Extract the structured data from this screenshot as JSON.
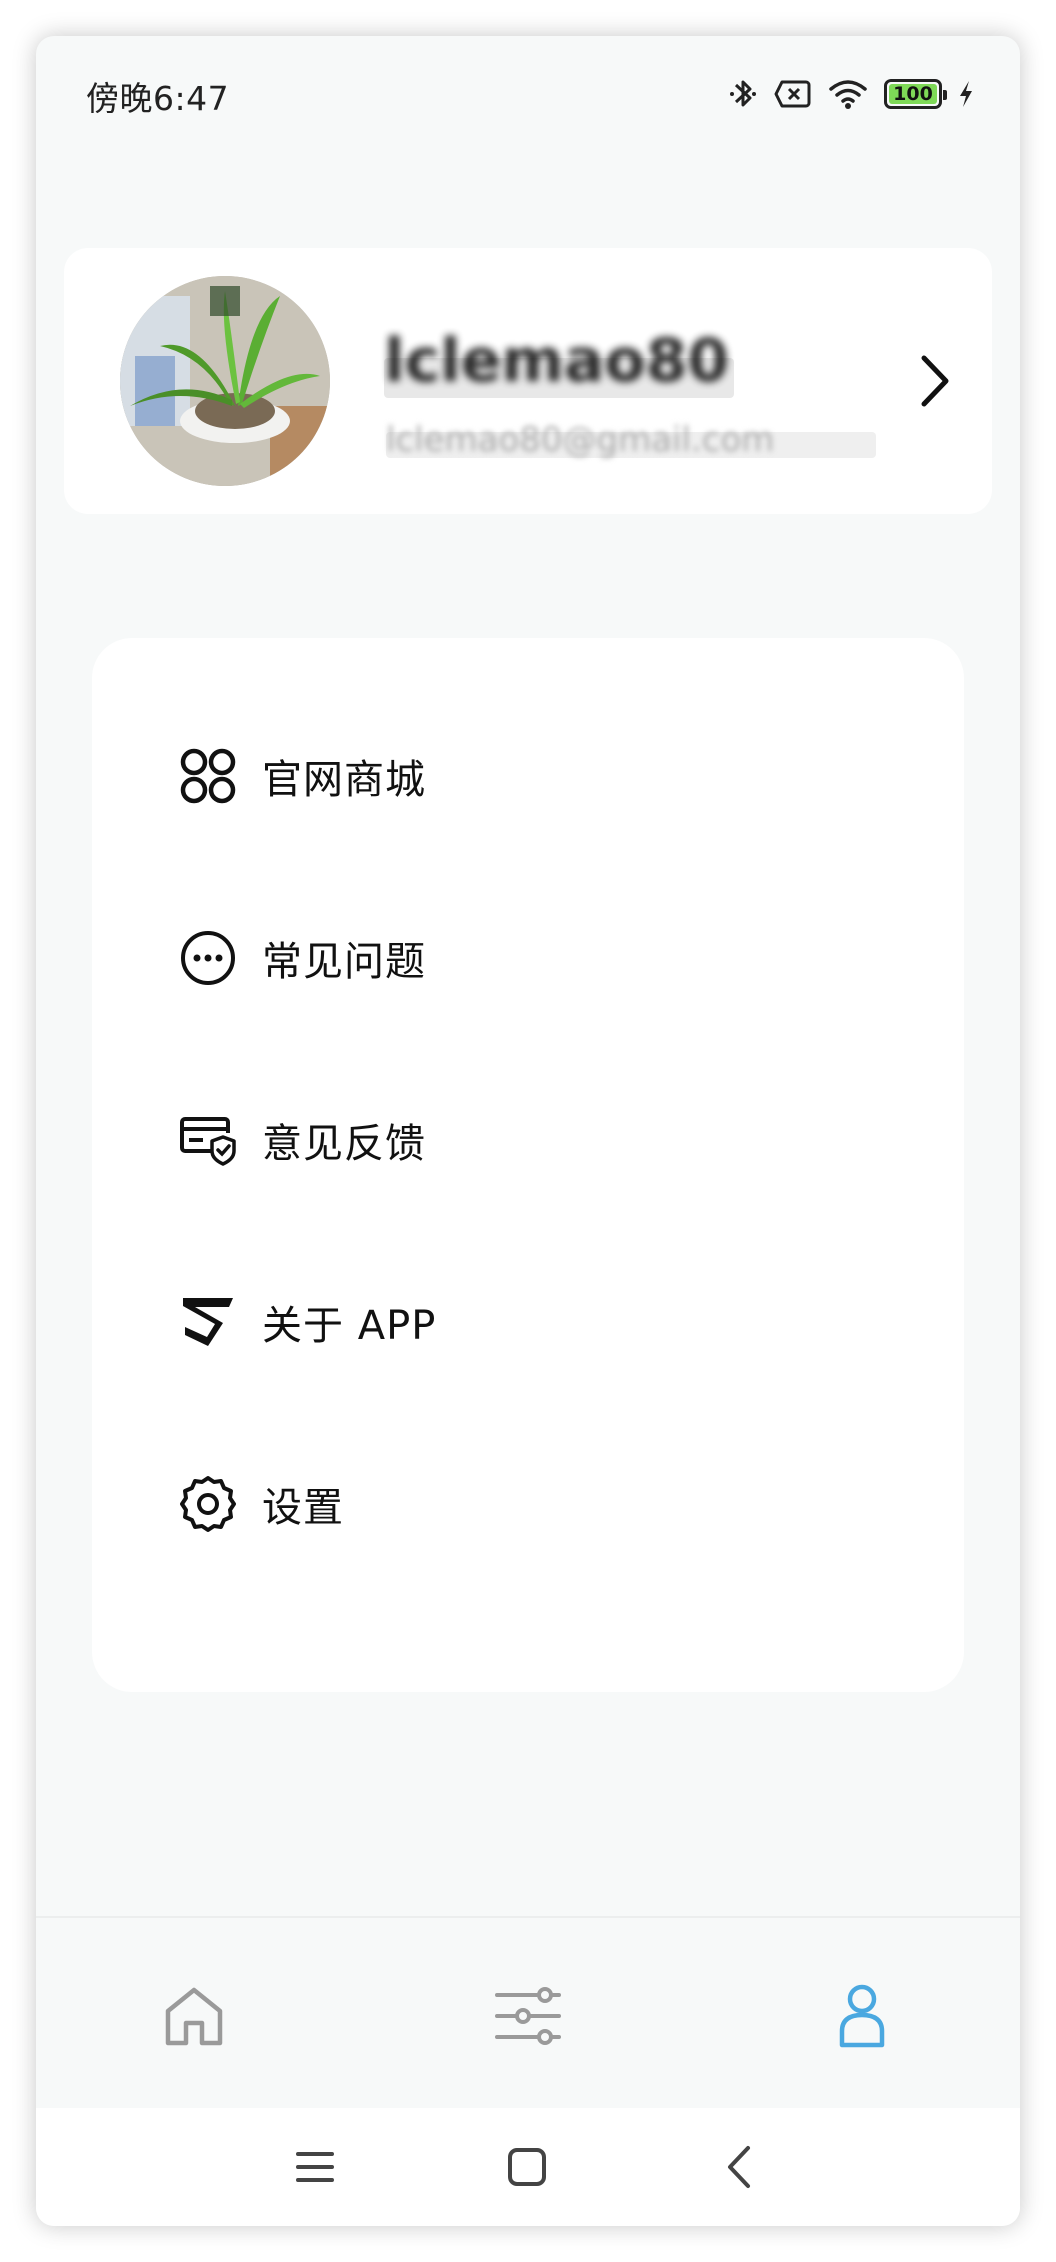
{
  "status_bar": {
    "time": "傍晚6:47",
    "battery_level": "100",
    "battery_color": "#7ed957",
    "icons": [
      "bluetooth-icon",
      "no-sim-icon",
      "wifi-icon",
      "battery-icon",
      "charging-icon"
    ]
  },
  "profile": {
    "name": "lclemao80",
    "email": "lclemao80@gmail.com",
    "chevron_icon": "chevron-right-icon"
  },
  "menu": {
    "items": [
      {
        "label": "官网商城",
        "icon": "store-grid-icon"
      },
      {
        "label": "常见问题",
        "icon": "faq-dots-icon"
      },
      {
        "label": "意见反馈",
        "icon": "feedback-card-icon"
      },
      {
        "label": "关于 APP",
        "icon": "app-logo-icon"
      },
      {
        "label": "设置",
        "icon": "settings-gear-icon"
      }
    ]
  },
  "tab_bar": {
    "tabs": [
      {
        "name": "home",
        "icon": "home-icon",
        "active": false
      },
      {
        "name": "controls",
        "icon": "sliders-icon",
        "active": false
      },
      {
        "name": "profile",
        "icon": "person-icon",
        "active": true
      }
    ],
    "active_color": "#4aa8e0",
    "inactive_color": "#9a9a9a"
  },
  "system_nav": {
    "buttons": [
      "menu-icon",
      "home-square-icon",
      "back-icon"
    ]
  }
}
